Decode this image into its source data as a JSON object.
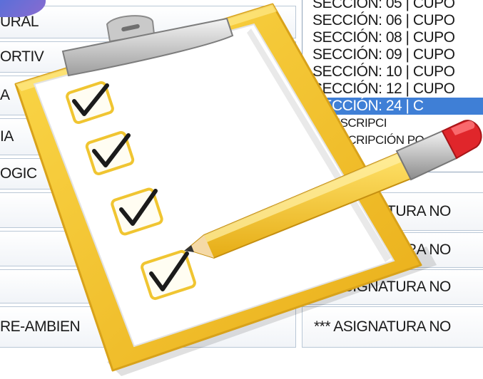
{
  "left_column": {
    "rows": [
      {
        "label": "URAL"
      },
      {
        "label": "ORTIV"
      },
      {
        "label": "A"
      },
      {
        "label": "IA"
      },
      {
        "label": "OGIC"
      },
      {
        "label": ""
      },
      {
        "label": ""
      },
      {
        "label": ""
      },
      {
        "label": "RE-AMBIEN"
      }
    ]
  },
  "section_dropdown": {
    "options": [
      "SECCIÓN: 05 | CUPO",
      "SECCIÓN: 06 | CUPO",
      "SECCIÓN: 08 | CUPO",
      "SECCIÓN: 09 | CUPO",
      "SECCIÓN: 10 | CUPO",
      "SECCIÓN: 12 | CUPO",
      "SECCIÓN: 24 | C",
      "*** INSCRIPCI",
      "*** INSCRIPCIÓN PO"
    ],
    "selected_index": 6
  },
  "right_column": {
    "rows": [
      {
        "label": "*** ASIGNATURA NO"
      },
      {
        "label": "*** ASIGNATURA NO"
      },
      {
        "label": "*** ASIGNATURA NO"
      },
      {
        "label": "*** ASIGNATURA NO"
      }
    ]
  },
  "colors": {
    "selection": "#3f7fd6",
    "clipboard": "#f3c42c",
    "pencil_eraser": "#e0262b",
    "checkbox_border": "#f0c531"
  },
  "icons": [
    "clipboard-checklist-icon",
    "pencil-icon",
    "checkmark-icon"
  ]
}
